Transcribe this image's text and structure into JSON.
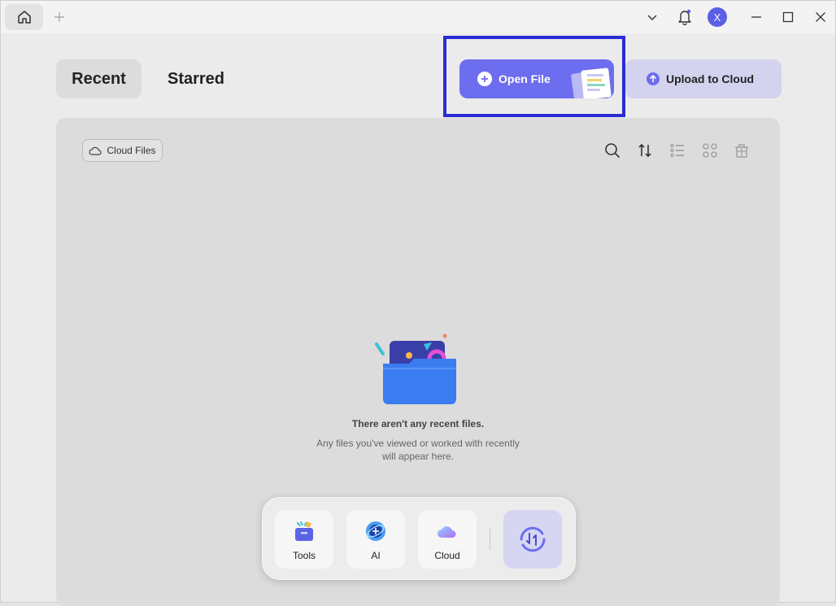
{
  "titlebar": {
    "avatar_initial": "X"
  },
  "tabs": [
    {
      "label": "Recent",
      "active": true
    },
    {
      "label": "Starred",
      "active": false
    }
  ],
  "actions": {
    "open_file": "Open File",
    "upload": "Upload to Cloud"
  },
  "panel": {
    "cloud_files": "Cloud Files",
    "empty_title": "There aren't any recent files.",
    "empty_desc": "Any files you've viewed or worked with recently will appear here."
  },
  "dock": {
    "items": [
      {
        "label": "Tools",
        "icon": "tools-icon"
      },
      {
        "label": "AI",
        "icon": "ai-icon"
      },
      {
        "label": "Cloud",
        "icon": "cloud-icon"
      }
    ],
    "sync_icon": "sync-icon"
  },
  "colors": {
    "accent": "#6d6df0",
    "highlight": "#2b2bd6",
    "upload_bg": "#d3d3ef"
  }
}
